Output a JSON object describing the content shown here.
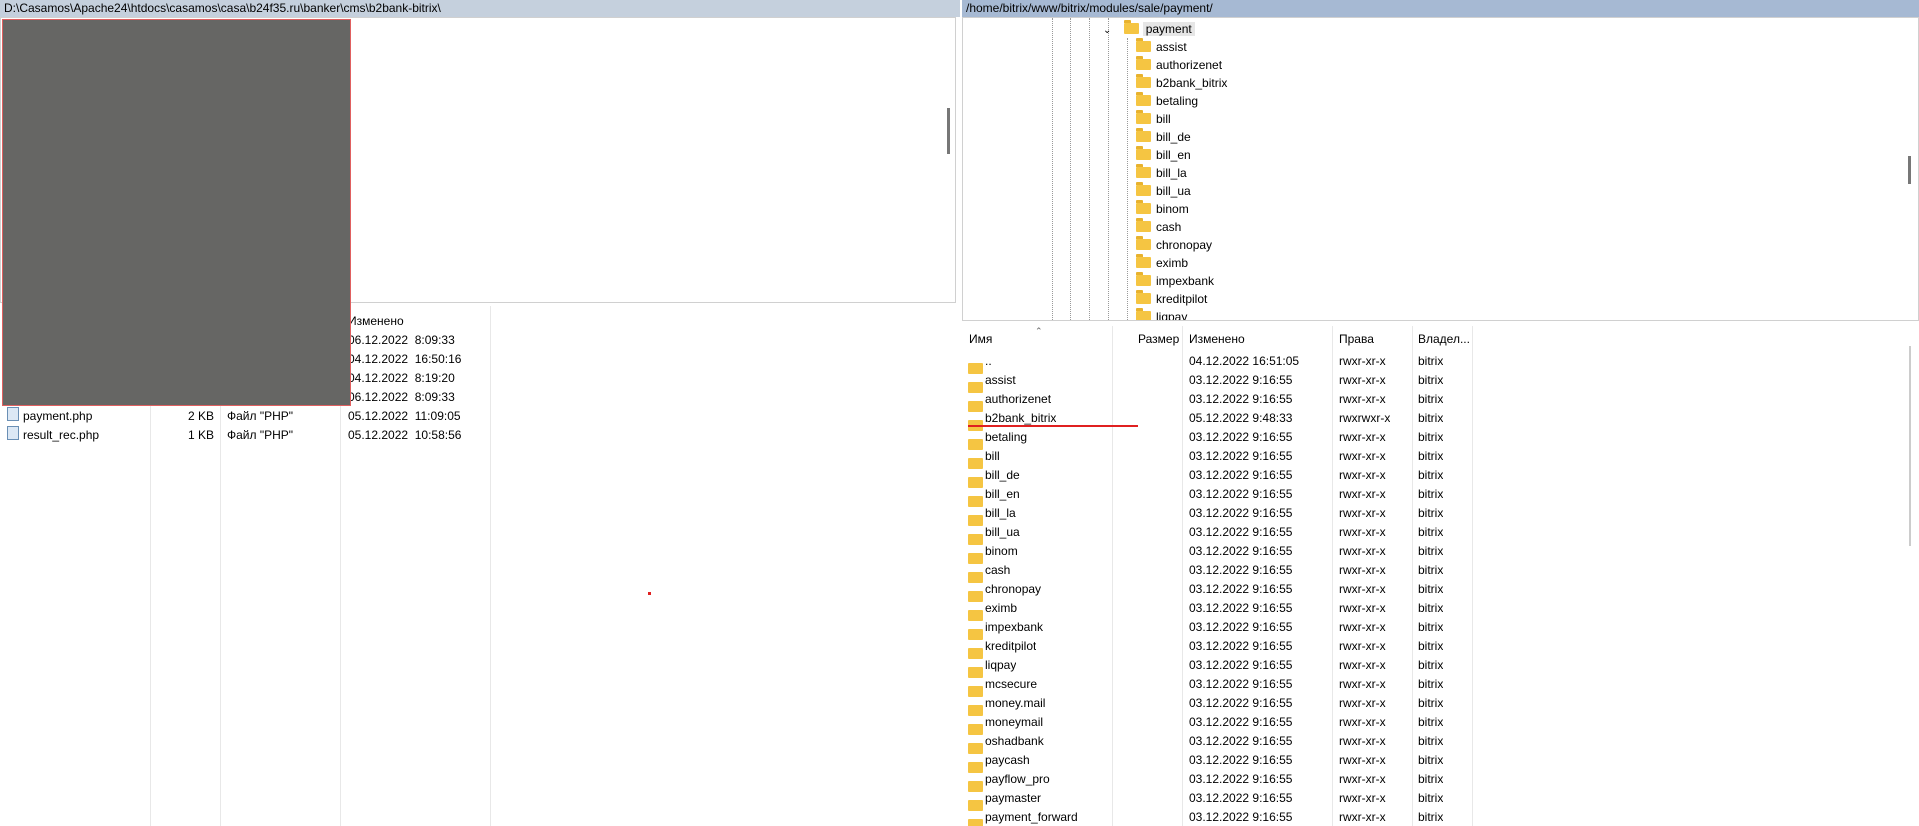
{
  "left": {
    "path": "D:\\Casamos\\Apache24\\htdocs\\casamos\\casa\\b24f35.ru\\banker\\cms\\b2bank-bitrix\\",
    "columns": {
      "modified": "Изменено"
    },
    "rows": [
      {
        "name": "",
        "size": "",
        "type": "",
        "modified": "06.12.2022  8:09:33"
      },
      {
        "name": "",
        "size": "",
        "type": "",
        "modified": "04.12.2022  16:50:16"
      },
      {
        "name": "",
        "size": "",
        "type": "",
        "modified": "04.12.2022  8:19:20"
      },
      {
        "name": "",
        "size": "",
        "type": "",
        "modified": "06.12.2022  8:09:33"
      },
      {
        "name": "payment.php",
        "size": "2 KB",
        "type": "Файл \"PHP\"",
        "modified": "05.12.2022  11:09:05"
      },
      {
        "name": "result_rec.php",
        "size": "1 KB",
        "type": "Файл \"PHP\"",
        "modified": "05.12.2022  10:58:56"
      }
    ]
  },
  "right": {
    "path": "/home/bitrix/www/bitrix/modules/sale/payment/",
    "tree": {
      "selected": "payment",
      "children": [
        "assist",
        "authorizenet",
        "b2bank_bitrix",
        "betaling",
        "bill",
        "bill_de",
        "bill_en",
        "bill_la",
        "bill_ua",
        "binom",
        "cash",
        "chronopay",
        "eximb",
        "impexbank",
        "kreditpilot",
        "liqpay"
      ]
    },
    "columns": {
      "name": "Имя",
      "size": "Размер",
      "modified": "Изменено",
      "perms": "Права",
      "owner": "Владел..."
    },
    "rows": [
      {
        "name": "..",
        "modified": "04.12.2022 16:51:05",
        "perms": "rwxr-xr-x",
        "owner": "bitrix"
      },
      {
        "name": "assist",
        "modified": "03.12.2022 9:16:55",
        "perms": "rwxr-xr-x",
        "owner": "bitrix"
      },
      {
        "name": "authorizenet",
        "modified": "03.12.2022 9:16:55",
        "perms": "rwxr-xr-x",
        "owner": "bitrix"
      },
      {
        "name": "b2bank_bitrix",
        "modified": "05.12.2022 9:48:33",
        "perms": "rwxrwxr-x",
        "owner": "bitrix"
      },
      {
        "name": "betaling",
        "modified": "03.12.2022 9:16:55",
        "perms": "rwxr-xr-x",
        "owner": "bitrix"
      },
      {
        "name": "bill",
        "modified": "03.12.2022 9:16:55",
        "perms": "rwxr-xr-x",
        "owner": "bitrix"
      },
      {
        "name": "bill_de",
        "modified": "03.12.2022 9:16:55",
        "perms": "rwxr-xr-x",
        "owner": "bitrix"
      },
      {
        "name": "bill_en",
        "modified": "03.12.2022 9:16:55",
        "perms": "rwxr-xr-x",
        "owner": "bitrix"
      },
      {
        "name": "bill_la",
        "modified": "03.12.2022 9:16:55",
        "perms": "rwxr-xr-x",
        "owner": "bitrix"
      },
      {
        "name": "bill_ua",
        "modified": "03.12.2022 9:16:55",
        "perms": "rwxr-xr-x",
        "owner": "bitrix"
      },
      {
        "name": "binom",
        "modified": "03.12.2022 9:16:55",
        "perms": "rwxr-xr-x",
        "owner": "bitrix"
      },
      {
        "name": "cash",
        "modified": "03.12.2022 9:16:55",
        "perms": "rwxr-xr-x",
        "owner": "bitrix"
      },
      {
        "name": "chronopay",
        "modified": "03.12.2022 9:16:55",
        "perms": "rwxr-xr-x",
        "owner": "bitrix"
      },
      {
        "name": "eximb",
        "modified": "03.12.2022 9:16:55",
        "perms": "rwxr-xr-x",
        "owner": "bitrix"
      },
      {
        "name": "impexbank",
        "modified": "03.12.2022 9:16:55",
        "perms": "rwxr-xr-x",
        "owner": "bitrix"
      },
      {
        "name": "kreditpilot",
        "modified": "03.12.2022 9:16:55",
        "perms": "rwxr-xr-x",
        "owner": "bitrix"
      },
      {
        "name": "liqpay",
        "modified": "03.12.2022 9:16:55",
        "perms": "rwxr-xr-x",
        "owner": "bitrix"
      },
      {
        "name": "mcsecure",
        "modified": "03.12.2022 9:16:55",
        "perms": "rwxr-xr-x",
        "owner": "bitrix"
      },
      {
        "name": "money.mail",
        "modified": "03.12.2022 9:16:55",
        "perms": "rwxr-xr-x",
        "owner": "bitrix"
      },
      {
        "name": "moneymail",
        "modified": "03.12.2022 9:16:55",
        "perms": "rwxr-xr-x",
        "owner": "bitrix"
      },
      {
        "name": "oshadbank",
        "modified": "03.12.2022 9:16:55",
        "perms": "rwxr-xr-x",
        "owner": "bitrix"
      },
      {
        "name": "paycash",
        "modified": "03.12.2022 9:16:55",
        "perms": "rwxr-xr-x",
        "owner": "bitrix"
      },
      {
        "name": "payflow_pro",
        "modified": "03.12.2022 9:16:55",
        "perms": "rwxr-xr-x",
        "owner": "bitrix"
      },
      {
        "name": "paymaster",
        "modified": "03.12.2022 9:16:55",
        "perms": "rwxr-xr-x",
        "owner": "bitrix"
      },
      {
        "name": "payment_forward",
        "modified": "03.12.2022 9:16:55",
        "perms": "rwxr-xr-x",
        "owner": "bitrix"
      }
    ]
  },
  "colors": {
    "left_path_bg": "#c5d0dd",
    "right_path_bg": "#a6b9d3",
    "annotation_red": "#e02020",
    "folder": "#f5c542"
  },
  "icons": {
    "folder": "folder-icon",
    "file": "php-file-icon",
    "parent": "parent-dir-icon",
    "expand": "chevron-down-icon"
  }
}
